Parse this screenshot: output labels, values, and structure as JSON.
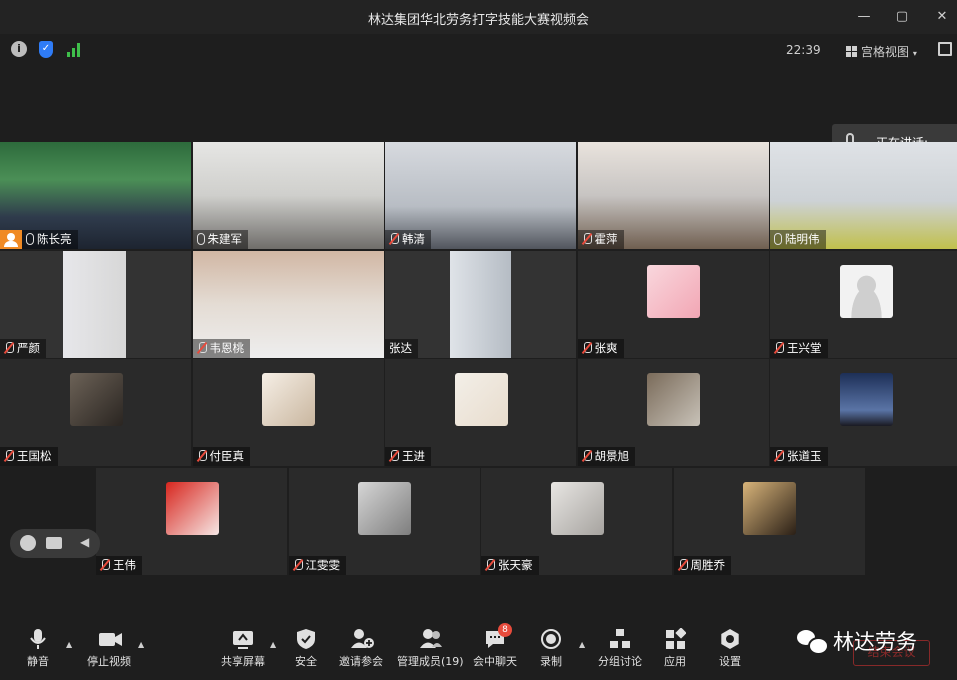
{
  "window": {
    "title": "林达集团华北劳务打字技能大赛视频会",
    "clock": "22:39",
    "view_mode": "宫格视图",
    "speaking_label": "正在讲话:"
  },
  "colors": {
    "accent": "#2f7cf6",
    "signal": "#3fbf4b",
    "host": "#f08a24",
    "muted": "#e84b3c",
    "badge": "#e84b3c"
  },
  "participants": [
    {
      "name": "陈长亮",
      "row": 0,
      "col": 0,
      "video": true,
      "host": true,
      "muted": false
    },
    {
      "name": "朱建军",
      "row": 0,
      "col": 1,
      "video": true,
      "host": false,
      "muted": false
    },
    {
      "name": "韩清",
      "row": 0,
      "col": 2,
      "video": true,
      "host": false,
      "muted": true
    },
    {
      "name": "霍萍",
      "row": 0,
      "col": 3,
      "video": true,
      "host": false,
      "muted": true
    },
    {
      "name": "陆明伟",
      "row": 0,
      "col": 4,
      "video": true,
      "host": false,
      "muted": false
    },
    {
      "name": "严颜",
      "row": 1,
      "col": 0,
      "video": true,
      "host": false,
      "muted": true
    },
    {
      "name": "韦恩桃",
      "row": 1,
      "col": 1,
      "video": true,
      "host": false,
      "muted": true
    },
    {
      "name": "张达",
      "row": 1,
      "col": 2,
      "video": true,
      "host": false,
      "muted": false
    },
    {
      "name": "张爽",
      "row": 1,
      "col": 3,
      "video": false,
      "host": false,
      "muted": true,
      "avatar": "anime-girl"
    },
    {
      "name": "王兴堂",
      "row": 1,
      "col": 4,
      "video": false,
      "host": false,
      "muted": true,
      "avatar": "default-person"
    },
    {
      "name": "王国松",
      "row": 2,
      "col": 0,
      "video": false,
      "host": false,
      "muted": true,
      "avatar": "portrait"
    },
    {
      "name": "付臣真",
      "row": 2,
      "col": 1,
      "video": false,
      "host": false,
      "muted": true,
      "avatar": "child"
    },
    {
      "name": "王进",
      "row": 2,
      "col": 2,
      "video": false,
      "host": false,
      "muted": true,
      "avatar": "cartoon"
    },
    {
      "name": "胡景旭",
      "row": 2,
      "col": 3,
      "video": false,
      "host": false,
      "muted": true,
      "avatar": "library"
    },
    {
      "name": "张道玉",
      "row": 2,
      "col": 4,
      "video": false,
      "host": false,
      "muted": true,
      "avatar": "night-sky"
    },
    {
      "name": "王伟",
      "row": 3,
      "col": 0,
      "video": false,
      "host": false,
      "muted": true,
      "avatar": "flag"
    },
    {
      "name": "江雯雯",
      "row": 3,
      "col": 1,
      "video": false,
      "host": false,
      "muted": true,
      "avatar": "collage"
    },
    {
      "name": "张天豪",
      "row": 3,
      "col": 2,
      "video": false,
      "host": false,
      "muted": true,
      "avatar": "sketch"
    },
    {
      "name": "周胜乔",
      "row": 3,
      "col": 3,
      "video": false,
      "host": false,
      "muted": true,
      "avatar": "mickey"
    }
  ],
  "toolbar": {
    "mute": "静音",
    "stop_video": "停止视频",
    "share_screen": "共享屏幕",
    "security": "安全",
    "invite": "邀请参会",
    "manage_members": "管理成员(19)",
    "chat": "会中聊天",
    "chat_badge": "8",
    "record": "录制",
    "breakout": "分组讨论",
    "apps": "应用",
    "settings": "设置",
    "end_meeting": "结束会议"
  },
  "watermark": {
    "brand": "林达劳务"
  }
}
